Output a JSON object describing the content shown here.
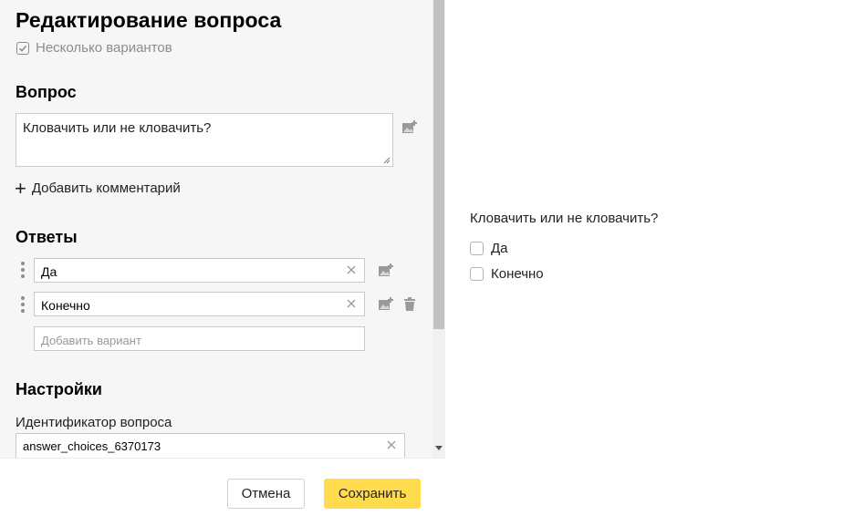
{
  "editor": {
    "title": "Редактирование вопроса",
    "multiple_label": "Несколько вариантов",
    "question_section": "Вопрос",
    "question_text": "Кловачить или не кловачить?",
    "add_comment_label": "Добавить комментарий",
    "answers_section": "Ответы",
    "answers": [
      {
        "value": "Да"
      },
      {
        "value": "Конечно"
      }
    ],
    "add_variant_placeholder": "Добавить вариант",
    "settings_section": "Настройки",
    "id_label": "Идентификатор вопроса",
    "id_value": "answer_choices_6370173"
  },
  "footer": {
    "cancel_label": "Отмена",
    "save_label": "Сохранить"
  },
  "preview": {
    "question": "Кловачить или не кловачить?",
    "options": [
      "Да",
      "Конечно"
    ]
  },
  "colors": {
    "accent_button": "#ffdb4d",
    "panel_bg": "#f6f6f6",
    "muted_text": "#8c8c8c"
  },
  "icons": [
    "check-icon",
    "image-add-icon",
    "plus-icon",
    "drag-handle-icon",
    "clear-icon",
    "trash-icon",
    "scroll-down-arrow-icon"
  ]
}
